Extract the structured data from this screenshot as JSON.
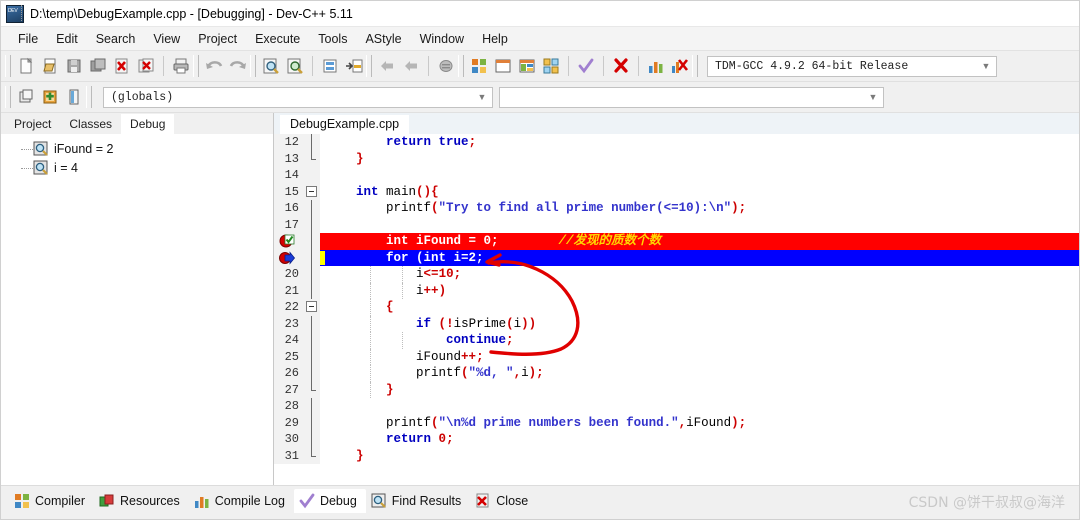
{
  "window": {
    "title": "D:\\temp\\DebugExample.cpp - [Debugging] - Dev-C++ 5.11",
    "app_icon": "dev-cpp-icon"
  },
  "menubar": {
    "items": [
      {
        "label": "File"
      },
      {
        "label": "Edit"
      },
      {
        "label": "Search"
      },
      {
        "label": "View"
      },
      {
        "label": "Project"
      },
      {
        "label": "Execute"
      },
      {
        "label": "Tools"
      },
      {
        "label": "AStyle"
      },
      {
        "label": "Window"
      },
      {
        "label": "Help"
      }
    ]
  },
  "toolbar": {
    "compiler_combo_value": "TDM-GCC 4.9.2 64-bit Release",
    "buttons": [
      {
        "name": "new-file-icon"
      },
      {
        "name": "open-file-icon"
      },
      {
        "name": "save-file-icon"
      },
      {
        "name": "save-all-icon"
      },
      {
        "name": "close-file-icon"
      },
      {
        "name": "close-all-icon"
      },
      {
        "name": "print-icon"
      },
      {
        "name": "undo-icon"
      },
      {
        "name": "redo-icon"
      },
      {
        "name": "find-icon"
      },
      {
        "name": "replace-icon"
      },
      {
        "name": "goto-line-icon"
      },
      {
        "name": "goto-function-icon"
      },
      {
        "name": "back-icon"
      },
      {
        "name": "forward-icon"
      },
      {
        "name": "toggle-breakpoint-icon"
      },
      {
        "name": "compile-icon"
      },
      {
        "name": "run-icon"
      },
      {
        "name": "compile-run-icon"
      },
      {
        "name": "rebuild-all-icon"
      },
      {
        "name": "syntax-check-icon"
      },
      {
        "name": "stop-execution-icon"
      },
      {
        "name": "profile-icon"
      },
      {
        "name": "delete-profile-icon"
      }
    ]
  },
  "toolbar2": {
    "globals_combo_value": "(globals)",
    "empty_combo_value": "",
    "buttons": [
      {
        "name": "project-manager-icon"
      },
      {
        "name": "add-to-project-icon"
      },
      {
        "name": "class-browser-icon"
      }
    ]
  },
  "left_panel": {
    "tabs": [
      {
        "label": "Project",
        "active": false
      },
      {
        "label": "Classes",
        "active": false
      },
      {
        "label": "Debug",
        "active": true
      }
    ],
    "watches": [
      {
        "label": "iFound = 2",
        "icon": "watch-magnifier-icon"
      },
      {
        "label": "i = 4",
        "icon": "watch-magnifier-icon"
      }
    ]
  },
  "editor": {
    "tab_label": "DebugExample.cpp",
    "lines": [
      {
        "num": "12",
        "state": "normal",
        "fold": "vline",
        "text": "        return true;"
      },
      {
        "num": "13",
        "state": "normal",
        "fold": "end",
        "text": "    }"
      },
      {
        "num": "14",
        "state": "normal",
        "fold": "none",
        "text": ""
      },
      {
        "num": "15",
        "state": "normal",
        "fold": "start",
        "text": "    int main(){"
      },
      {
        "num": "16",
        "state": "normal",
        "fold": "vline",
        "text": "        printf(\"Try to find all prime number(<=10):\\n\");"
      },
      {
        "num": "17",
        "state": "normal",
        "fold": "vline",
        "text": ""
      },
      {
        "num": "18",
        "state": "breakpoint",
        "marker": "breakpoint-active-icon",
        "fold": "vline",
        "text": "        int iFound = 0;        //发现的质数个数"
      },
      {
        "num": "19",
        "state": "current",
        "marker": "current-line-arrow-icon",
        "fold": "vline",
        "text": "        for (int i=2;"
      },
      {
        "num": "20",
        "state": "normal",
        "fold": "vline",
        "text": "            i<=10;"
      },
      {
        "num": "21",
        "state": "normal",
        "fold": "vline",
        "text": "            i++)"
      },
      {
        "num": "22",
        "state": "normal",
        "fold": "start",
        "text": "        {"
      },
      {
        "num": "23",
        "state": "normal",
        "fold": "vline",
        "text": "            if (!isPrime(i))"
      },
      {
        "num": "24",
        "state": "normal",
        "fold": "vline",
        "text": "                continue;"
      },
      {
        "num": "25",
        "state": "normal",
        "fold": "vline",
        "text": "            iFound++;"
      },
      {
        "num": "26",
        "state": "normal",
        "fold": "vline",
        "text": "            printf(\"%d, \",i);"
      },
      {
        "num": "27",
        "state": "normal",
        "fold": "end",
        "text": "        }"
      },
      {
        "num": "28",
        "state": "normal",
        "fold": "vline",
        "text": ""
      },
      {
        "num": "29",
        "state": "normal",
        "fold": "vline",
        "text": "        printf(\"\\n%d prime numbers been found.\",iFound);"
      },
      {
        "num": "30",
        "state": "normal",
        "fold": "vline",
        "text": "        return 0;"
      },
      {
        "num": "31",
        "state": "normal",
        "fold": "end",
        "text": "    }"
      }
    ]
  },
  "bottom_tabs": [
    {
      "label": "Compiler",
      "icon": "compiler-icon",
      "active": false
    },
    {
      "label": "Resources",
      "icon": "resources-icon",
      "active": false
    },
    {
      "label": "Compile Log",
      "icon": "compile-log-icon",
      "active": false
    },
    {
      "label": "Debug",
      "icon": "debug-check-icon",
      "active": true
    },
    {
      "label": "Find Results",
      "icon": "find-results-icon",
      "active": false
    },
    {
      "label": "Close",
      "icon": "close-red-icon",
      "active": false
    }
  ],
  "watermark": "CSDN @饼干叔叔@海洋",
  "colors": {
    "breakpoint_line": "#ff0000",
    "current_line": "#0000ff",
    "annotation": "#e00000",
    "comment": "#ffd800"
  }
}
